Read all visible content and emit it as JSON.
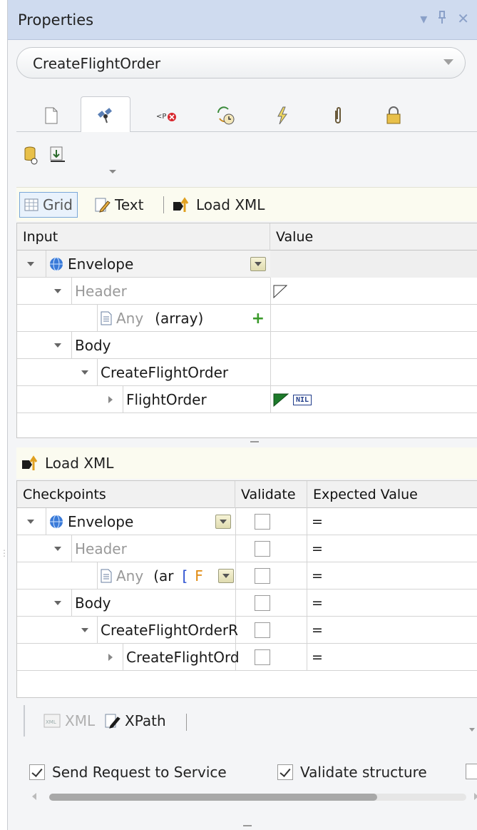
{
  "window": {
    "title": "Properties"
  },
  "selector": {
    "value": "CreateFlightOrder"
  },
  "tabs": [
    {
      "icon": "document-icon"
    },
    {
      "icon": "satellite-icon"
    },
    {
      "icon": "xml-error-icon"
    },
    {
      "icon": "transform-clock-icon"
    },
    {
      "icon": "lightning-icon"
    },
    {
      "icon": "paperclip-icon"
    },
    {
      "icon": "lock-icon"
    }
  ],
  "input_toolbar": {
    "grid_label": "Grid",
    "text_label": "Text",
    "load_label": "Load XML"
  },
  "input_grid": {
    "headers": [
      "Input",
      "Value"
    ],
    "rows": [
      {
        "label": "Envelope"
      },
      {
        "label": "Header"
      },
      {
        "label": "Any",
        "suffix": "(array)"
      },
      {
        "label": "Body"
      },
      {
        "label": "CreateFlightOrder"
      },
      {
        "label": "FlightOrder",
        "badge": "NIL"
      }
    ]
  },
  "checkpoints_toolbar": {
    "load_label": "Load XML"
  },
  "checkpoints_grid": {
    "headers": [
      "Checkpoints",
      "Validate",
      "Expected Value"
    ],
    "rows": [
      {
        "label": "Envelope",
        "expected": "="
      },
      {
        "label": "Header",
        "expected": "="
      },
      {
        "label": "Any",
        "suffix": "(ar",
        "extra": "[",
        "extra2": "F",
        "expected": "="
      },
      {
        "label": "Body",
        "expected": "="
      },
      {
        "label": "CreateFlightOrderR",
        "expected": "="
      },
      {
        "label": "CreateFlightOrd",
        "expected": "="
      }
    ]
  },
  "bottom_toolbar": {
    "xml_label": "XML",
    "xpath_label": "XPath"
  },
  "options": {
    "send_request": "Send Request to Service",
    "validate_structure": "Validate structure"
  }
}
